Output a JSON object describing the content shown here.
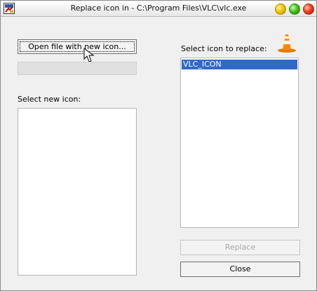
{
  "window": {
    "title": "Replace icon in - C:\\Program Files\\VLC\\vlc.exe"
  },
  "buttons": {
    "open_file": "Open file with new icon...",
    "replace": "Replace",
    "close": "Close"
  },
  "labels": {
    "select_new_icon": "Select new icon:",
    "select_icon_to_replace": "Select icon to replace:"
  },
  "icons_to_replace": [
    "VLC_ICON"
  ],
  "selected_icon": "VLC_ICON",
  "progress": 0,
  "icon_names": {
    "app": "icon-replacer-app-icon",
    "minimize": "minimize-icon",
    "maximize": "maximize-icon",
    "close": "close-icon",
    "vlc": "vlc-cone-icon",
    "cursor": "hand-cursor-icon"
  },
  "colors": {
    "selection": "#316ac5",
    "vlc_orange": "#ff8800"
  }
}
